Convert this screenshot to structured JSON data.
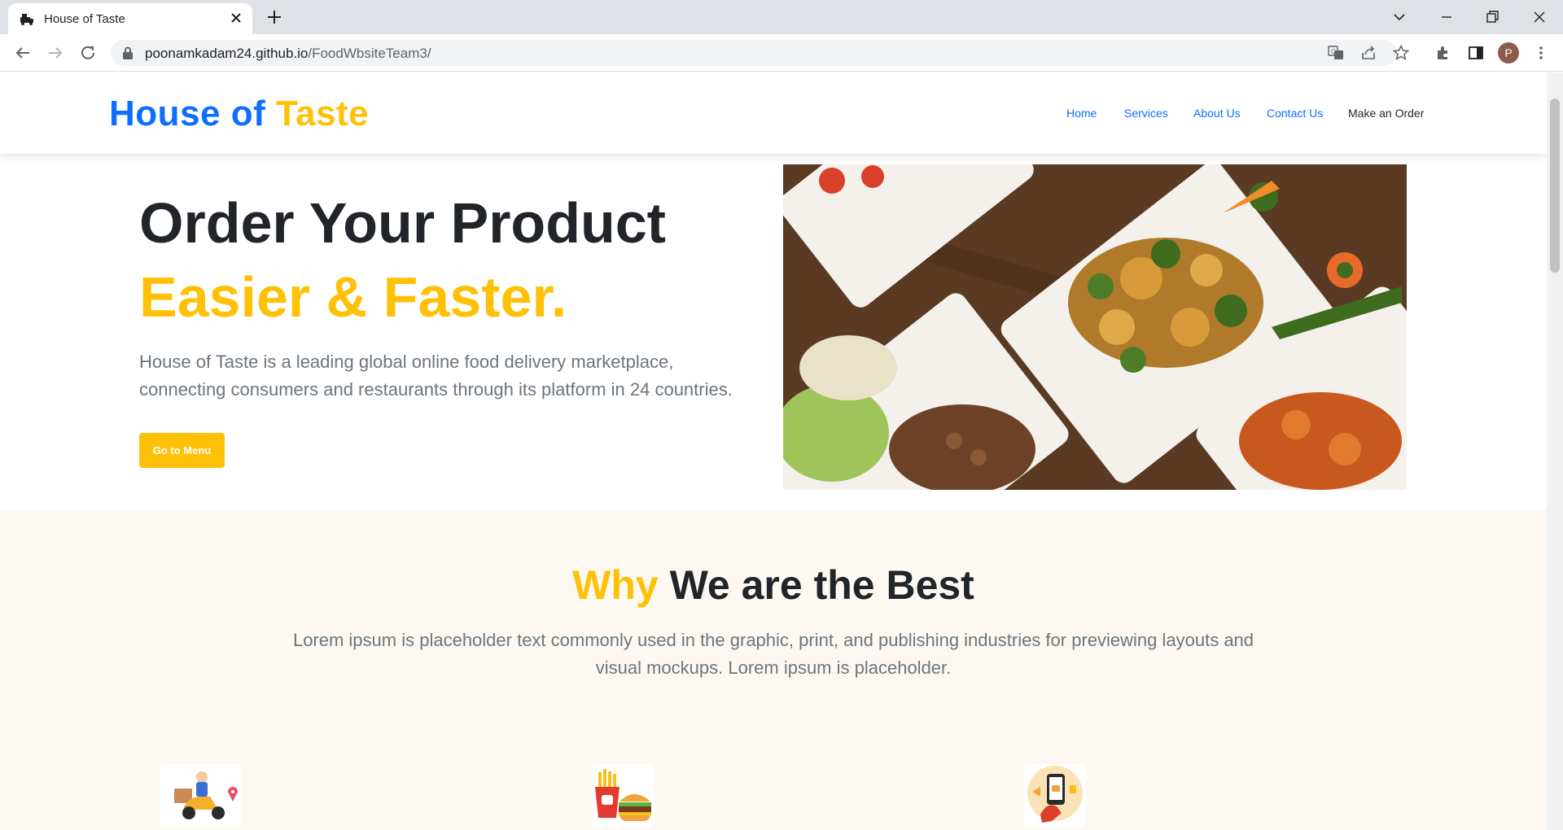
{
  "browser": {
    "tab_title": "House of Taste",
    "url_host": "poonamkadam24.github.io",
    "url_path": "/FoodWbsiteTeam3/",
    "profile_initial": "P"
  },
  "header": {
    "brand_part1": "House of",
    "brand_part2": "Taste",
    "nav": {
      "home": "Home",
      "services": "Services",
      "about": "About Us",
      "contact": "Contact Us",
      "order": "Make an Order"
    }
  },
  "hero": {
    "title_line1": "Order Your Product",
    "title_line2": "Easier & Faster.",
    "description": "House of Taste is a leading global online food delivery marketplace, connecting consumers and restaurants through its platform in 24 countries.",
    "cta_label": "Go to Menu"
  },
  "why": {
    "title_highlight": "Why",
    "title_rest": "We are the Best",
    "description": "Lorem ipsum is placeholder text commonly used in the graphic, print, and publishing industries for previewing layouts and visual mockups. Lorem ipsum is placeholder."
  },
  "icons": {
    "delivery": "delivery-scooter-icon",
    "fast_food": "fries-burger-icon",
    "mobile_order": "mobile-order-icon"
  },
  "colors": {
    "brand_blue": "#0d6efd",
    "brand_yellow": "#ffc107",
    "heading": "#212529",
    "muted": "#6c757d",
    "section_bg": "#fdf9f2"
  }
}
